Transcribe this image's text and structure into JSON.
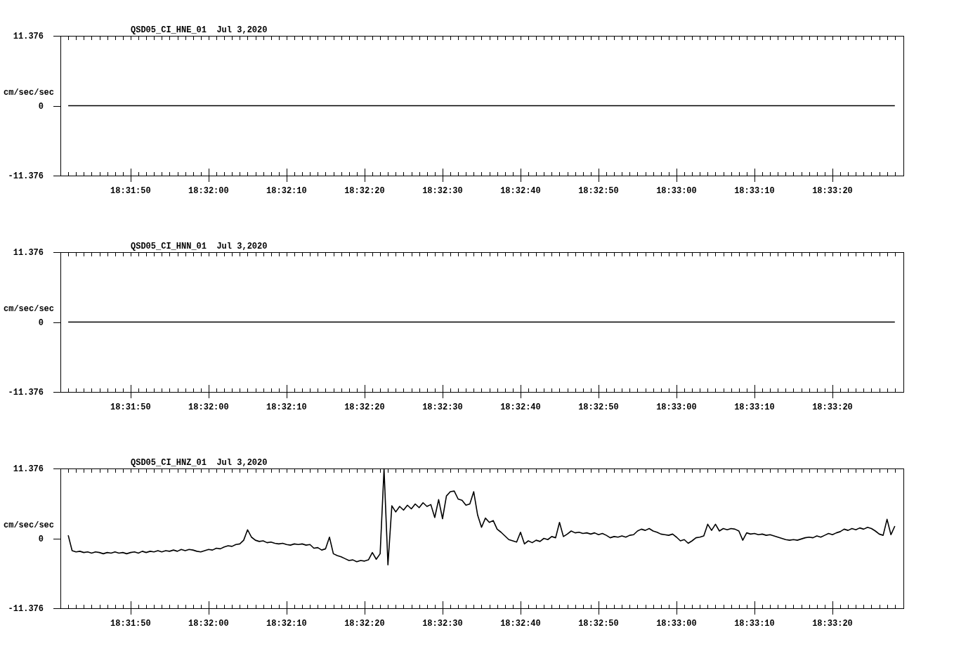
{
  "panels": [
    {
      "chart_data": {
        "type": "line",
        "title": "QSD05_CI_HNE_01  Jul 3,2020",
        "ylabel": "cm/sec/sec",
        "categories": [
          null,
          null,
          null,
          null,
          null,
          null,
          null,
          null,
          null,
          null,
          null,
          null,
          null,
          null,
          null,
          null,
          "18:31:50",
          null,
          null,
          null,
          null,
          null,
          null,
          null,
          null,
          null,
          null,
          null,
          null,
          null,
          null,
          null,
          null,
          null,
          null,
          null,
          "18:32:00",
          null,
          null,
          null,
          null,
          null,
          null,
          null,
          null,
          null,
          null,
          null,
          null,
          null,
          null,
          null,
          null,
          null,
          null,
          null,
          "18:32:10",
          null,
          null,
          null,
          null,
          null,
          null,
          null,
          null,
          null,
          null,
          null,
          null,
          null,
          null,
          null,
          null,
          null,
          null,
          null,
          "18:32:20",
          null,
          null,
          null,
          null,
          null,
          null,
          null,
          null,
          null,
          null,
          null,
          null,
          null,
          null,
          null,
          null,
          null,
          null,
          null,
          "18:32:30",
          null,
          null,
          null,
          null,
          null,
          null,
          null,
          null,
          null,
          null,
          null,
          null,
          null,
          null,
          null,
          null,
          null,
          null,
          null,
          "18:32:40",
          null,
          null,
          null,
          null,
          null,
          null,
          null,
          null,
          null,
          null,
          null,
          null,
          null,
          null,
          null,
          null,
          null,
          null,
          null,
          "18:32:50",
          null,
          null,
          null,
          null,
          null,
          null,
          null,
          null,
          null,
          null,
          null,
          null,
          null,
          null,
          null,
          null,
          null,
          null,
          null,
          "18:33:00",
          null,
          null,
          null,
          null,
          null,
          null,
          null,
          null,
          null,
          null,
          null,
          null,
          null,
          null,
          null,
          null,
          null,
          null,
          null,
          "18:33:10",
          null,
          null,
          null,
          null,
          null,
          null,
          null,
          null,
          null,
          null,
          null,
          null,
          null,
          null,
          null,
          null,
          null,
          null,
          null,
          "18:33:20",
          null,
          null,
          null,
          null,
          null,
          null,
          null,
          null,
          null,
          null,
          null,
          null,
          null,
          null,
          null,
          null
        ],
        "values": [
          0,
          0,
          0,
          0,
          0,
          0,
          0,
          0,
          0,
          0,
          0,
          0,
          0,
          0,
          0,
          0,
          0,
          0,
          0,
          0,
          0,
          0,
          0,
          0,
          0,
          0,
          0,
          0,
          0,
          0,
          0,
          0,
          0,
          0,
          0,
          0,
          0,
          0,
          0,
          0,
          0,
          0,
          0,
          0,
          0,
          0,
          0,
          0,
          0,
          0,
          0,
          0,
          0,
          0,
          0,
          0,
          0,
          0,
          0,
          0,
          0,
          0,
          0,
          0,
          0,
          0,
          0,
          0,
          0,
          0,
          0,
          0,
          0,
          0,
          0,
          0,
          0,
          0,
          0,
          0,
          0,
          0,
          0,
          0,
          0,
          0,
          0,
          0,
          0,
          0,
          0,
          0,
          0,
          0,
          0,
          0,
          0,
          0,
          0,
          0,
          0,
          0,
          0,
          0,
          0,
          0,
          0,
          0,
          0,
          0,
          0,
          0,
          0,
          0,
          0,
          0,
          0,
          0,
          0,
          0,
          0,
          0,
          0,
          0,
          0,
          0,
          0,
          0,
          0,
          0,
          0,
          0,
          0,
          0,
          0,
          0,
          0,
          0,
          0,
          0,
          0,
          0,
          0,
          0,
          0,
          0,
          0,
          0,
          0,
          0,
          0,
          0,
          0,
          0,
          0,
          0,
          0,
          0,
          0,
          0,
          0,
          0,
          0,
          0,
          0,
          0,
          0,
          0,
          0,
          0,
          0,
          0,
          0,
          0,
          0,
          0,
          0,
          0,
          0,
          0,
          0,
          0,
          0,
          0,
          0,
          0,
          0,
          0,
          0,
          0,
          0,
          0,
          0,
          0,
          0,
          0,
          0,
          0,
          0,
          0,
          0,
          0,
          0,
          0,
          0,
          0,
          0,
          0,
          0,
          0,
          0,
          0,
          0
        ],
        "ylim": [
          -11.376,
          11.376
        ],
        "yticks": [
          {
            "value": 11.376,
            "label": "11.376"
          },
          {
            "value": 0,
            "label": "0"
          },
          {
            "value": -11.376,
            "label": "-11.376"
          }
        ]
      }
    },
    {
      "chart_data": {
        "type": "line",
        "title": "QSD05_CI_HNN_01  Jul 3,2020",
        "ylabel": "cm/sec/sec",
        "categories": [
          null,
          null,
          null,
          null,
          null,
          null,
          null,
          null,
          null,
          null,
          null,
          null,
          null,
          null,
          null,
          null,
          "18:31:50",
          null,
          null,
          null,
          null,
          null,
          null,
          null,
          null,
          null,
          null,
          null,
          null,
          null,
          null,
          null,
          null,
          null,
          null,
          null,
          "18:32:00",
          null,
          null,
          null,
          null,
          null,
          null,
          null,
          null,
          null,
          null,
          null,
          null,
          null,
          null,
          null,
          null,
          null,
          null,
          null,
          "18:32:10",
          null,
          null,
          null,
          null,
          null,
          null,
          null,
          null,
          null,
          null,
          null,
          null,
          null,
          null,
          null,
          null,
          null,
          null,
          null,
          "18:32:20",
          null,
          null,
          null,
          null,
          null,
          null,
          null,
          null,
          null,
          null,
          null,
          null,
          null,
          null,
          null,
          null,
          null,
          null,
          null,
          "18:32:30",
          null,
          null,
          null,
          null,
          null,
          null,
          null,
          null,
          null,
          null,
          null,
          null,
          null,
          null,
          null,
          null,
          null,
          null,
          null,
          "18:32:40",
          null,
          null,
          null,
          null,
          null,
          null,
          null,
          null,
          null,
          null,
          null,
          null,
          null,
          null,
          null,
          null,
          null,
          null,
          null,
          "18:32:50",
          null,
          null,
          null,
          null,
          null,
          null,
          null,
          null,
          null,
          null,
          null,
          null,
          null,
          null,
          null,
          null,
          null,
          null,
          null,
          "18:33:00",
          null,
          null,
          null,
          null,
          null,
          null,
          null,
          null,
          null,
          null,
          null,
          null,
          null,
          null,
          null,
          null,
          null,
          null,
          null,
          "18:33:10",
          null,
          null,
          null,
          null,
          null,
          null,
          null,
          null,
          null,
          null,
          null,
          null,
          null,
          null,
          null,
          null,
          null,
          null,
          null,
          "18:33:20",
          null,
          null,
          null,
          null,
          null,
          null,
          null,
          null,
          null,
          null,
          null,
          null,
          null,
          null,
          null,
          null
        ],
        "values": [
          0,
          0,
          0,
          0,
          0,
          0,
          0,
          0,
          0,
          0,
          0,
          0,
          0,
          0,
          0,
          0,
          0,
          0,
          0,
          0,
          0,
          0,
          0,
          0,
          0,
          0,
          0,
          0,
          0,
          0,
          0,
          0,
          0,
          0,
          0,
          0,
          0,
          0,
          0,
          0,
          0,
          0,
          0,
          0,
          0,
          0,
          0,
          0,
          0,
          0,
          0,
          0,
          0,
          0,
          0,
          0,
          0,
          0,
          0,
          0,
          0,
          0,
          0,
          0,
          0,
          0,
          0,
          0,
          0,
          0,
          0,
          0,
          0,
          0,
          0,
          0,
          0,
          0,
          0,
          0,
          0,
          0,
          0,
          0,
          0,
          0,
          0,
          0,
          0,
          0,
          0,
          0,
          0,
          0,
          0,
          0,
          0,
          0,
          0,
          0,
          0,
          0,
          0,
          0,
          0,
          0,
          0,
          0,
          0,
          0,
          0,
          0,
          0,
          0,
          0,
          0,
          0,
          0,
          0,
          0,
          0,
          0,
          0,
          0,
          0,
          0,
          0,
          0,
          0,
          0,
          0,
          0,
          0,
          0,
          0,
          0,
          0,
          0,
          0,
          0,
          0,
          0,
          0,
          0,
          0,
          0,
          0,
          0,
          0,
          0,
          0,
          0,
          0,
          0,
          0,
          0,
          0,
          0,
          0,
          0,
          0,
          0,
          0,
          0,
          0,
          0,
          0,
          0,
          0,
          0,
          0,
          0,
          0,
          0,
          0,
          0,
          0,
          0,
          0,
          0,
          0,
          0,
          0,
          0,
          0,
          0,
          0,
          0,
          0,
          0,
          0,
          0,
          0,
          0,
          0,
          0,
          0,
          0,
          0,
          0,
          0,
          0,
          0,
          0,
          0,
          0,
          0,
          0,
          0,
          0,
          0,
          0,
          0
        ],
        "ylim": [
          -11.376,
          11.376
        ],
        "yticks": [
          {
            "value": 11.376,
            "label": "11.376"
          },
          {
            "value": 0,
            "label": "0"
          },
          {
            "value": -11.376,
            "label": "-11.376"
          }
        ]
      }
    },
    {
      "chart_data": {
        "type": "line",
        "title": "QSD05_CI_HNZ_01  Jul 3,2020",
        "ylabel": "cm/sec/sec",
        "categories": [
          null,
          null,
          null,
          null,
          null,
          null,
          null,
          null,
          null,
          null,
          null,
          null,
          null,
          null,
          null,
          null,
          "18:31:50",
          null,
          null,
          null,
          null,
          null,
          null,
          null,
          null,
          null,
          null,
          null,
          null,
          null,
          null,
          null,
          null,
          null,
          null,
          null,
          "18:32:00",
          null,
          null,
          null,
          null,
          null,
          null,
          null,
          null,
          null,
          null,
          null,
          null,
          null,
          null,
          null,
          null,
          null,
          null,
          null,
          "18:32:10",
          null,
          null,
          null,
          null,
          null,
          null,
          null,
          null,
          null,
          null,
          null,
          null,
          null,
          null,
          null,
          null,
          null,
          null,
          null,
          "18:32:20",
          null,
          null,
          null,
          null,
          null,
          null,
          null,
          null,
          null,
          null,
          null,
          null,
          null,
          null,
          null,
          null,
          null,
          null,
          null,
          "18:32:30",
          null,
          null,
          null,
          null,
          null,
          null,
          null,
          null,
          null,
          null,
          null,
          null,
          null,
          null,
          null,
          null,
          null,
          null,
          null,
          "18:32:40",
          null,
          null,
          null,
          null,
          null,
          null,
          null,
          null,
          null,
          null,
          null,
          null,
          null,
          null,
          null,
          null,
          null,
          null,
          null,
          "18:32:50",
          null,
          null,
          null,
          null,
          null,
          null,
          null,
          null,
          null,
          null,
          null,
          null,
          null,
          null,
          null,
          null,
          null,
          null,
          null,
          "18:33:00",
          null,
          null,
          null,
          null,
          null,
          null,
          null,
          null,
          null,
          null,
          null,
          null,
          null,
          null,
          null,
          null,
          null,
          null,
          null,
          "18:33:10",
          null,
          null,
          null,
          null,
          null,
          null,
          null,
          null,
          null,
          null,
          null,
          null,
          null,
          null,
          null,
          null,
          null,
          null,
          null,
          "18:33:20",
          null,
          null,
          null,
          null,
          null,
          null,
          null,
          null,
          null,
          null,
          null,
          null,
          null,
          null,
          null,
          null
        ],
        "values": [
          0.5,
          -2.0,
          -2.2,
          -2.1,
          -2.3,
          -2.2,
          -2.4,
          -2.2,
          -2.3,
          -2.5,
          -2.3,
          -2.4,
          -2.2,
          -2.4,
          -2.3,
          -2.5,
          -2.3,
          -2.2,
          -2.4,
          -2.1,
          -2.3,
          -2.1,
          -2.2,
          -2.0,
          -2.2,
          -2.0,
          -2.1,
          -1.9,
          -2.1,
          -1.8,
          -2.0,
          -1.8,
          -1.9,
          -2.1,
          -2.2,
          -2.0,
          -1.8,
          -1.9,
          -1.6,
          -1.7,
          -1.4,
          -1.2,
          -1.3,
          -1.0,
          -0.9,
          -0.3,
          1.4,
          0.2,
          -0.3,
          -0.5,
          -0.4,
          -0.7,
          -0.6,
          -0.8,
          -0.9,
          -0.8,
          -1.0,
          -1.1,
          -0.9,
          -1.0,
          -0.9,
          -1.1,
          -1.0,
          -1.6,
          -1.5,
          -1.9,
          -1.7,
          0.2,
          -2.5,
          -2.8,
          -3.0,
          -3.3,
          -3.6,
          -3.5,
          -3.8,
          -3.6,
          -3.7,
          -3.5,
          -2.3,
          -3.4,
          -2.5,
          11.3,
          -4.3,
          5.3,
          4.3,
          5.2,
          4.6,
          5.4,
          4.8,
          5.6,
          5.0,
          5.8,
          5.2,
          5.5,
          3.4,
          6.3,
          3.2,
          6.9,
          7.6,
          7.7,
          6.4,
          6.2,
          5.4,
          5.6,
          7.6,
          3.8,
          1.8,
          3.3,
          2.6,
          2.9,
          1.5,
          1.0,
          0.4,
          -0.2,
          -0.4,
          -0.6,
          1.0,
          -0.9,
          -0.4,
          -0.7,
          -0.3,
          -0.5,
          0.0,
          -0.2,
          0.3,
          0.1,
          2.6,
          0.3,
          0.7,
          1.2,
          0.9,
          1.0,
          0.8,
          0.9,
          0.7,
          0.9,
          0.6,
          0.8,
          0.5,
          0.1,
          0.3,
          0.2,
          0.4,
          0.2,
          0.5,
          0.6,
          1.2,
          1.5,
          1.3,
          1.6,
          1.2,
          1.0,
          0.7,
          0.6,
          0.5,
          0.7,
          0.2,
          -0.4,
          -0.2,
          -0.8,
          -0.4,
          0.1,
          0.2,
          0.4,
          2.3,
          1.3,
          2.3,
          1.2,
          1.6,
          1.4,
          1.6,
          1.5,
          1.2,
          -0.3,
          0.9,
          0.7,
          0.8,
          0.6,
          0.7,
          0.5,
          0.6,
          0.4,
          0.2,
          0.0,
          -0.2,
          -0.3,
          -0.2,
          -0.3,
          -0.1,
          0.1,
          0.2,
          0.1,
          0.4,
          0.2,
          0.5,
          0.8,
          0.6,
          0.9,
          1.1,
          1.5,
          1.3,
          1.6,
          1.4,
          1.7,
          1.5,
          1.8,
          1.6,
          1.2,
          0.7,
          0.5,
          3.1,
          0.6,
          2.0
        ],
        "ylim": [
          -11.376,
          11.376
        ],
        "yticks": [
          {
            "value": 11.376,
            "label": "11.376"
          },
          {
            "value": 0,
            "label": "0"
          },
          {
            "value": -11.376,
            "label": "-11.376"
          }
        ]
      }
    }
  ]
}
